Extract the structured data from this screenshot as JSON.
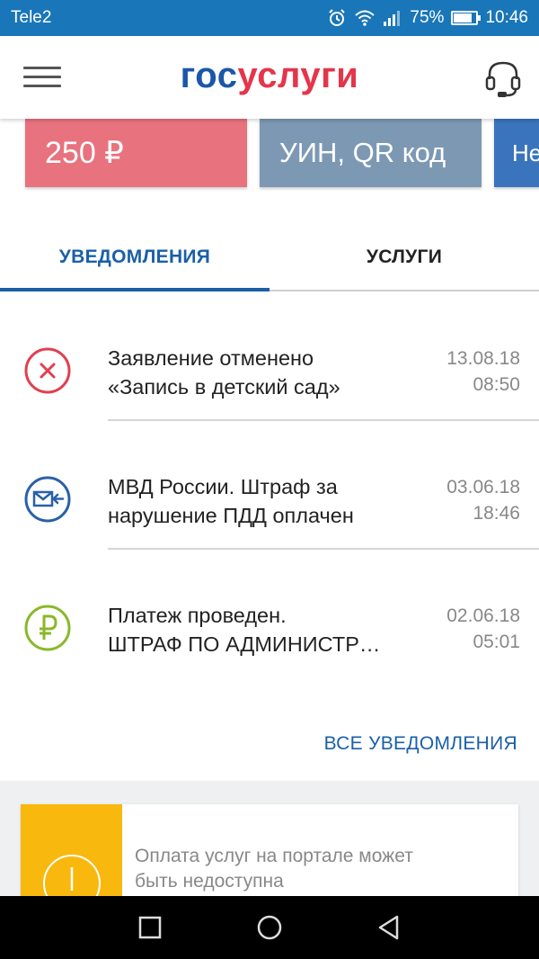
{
  "status_bar": {
    "carrier": "Tele2",
    "battery_percent": "75%",
    "battery_level": 0.75,
    "time": "10:46"
  },
  "header": {
    "logo_part1": "гос",
    "logo_part2": "услуги",
    "menu_icon": "hamburger-menu-icon",
    "support_icon": "headset-icon"
  },
  "cards": [
    {
      "label": "250 ₽"
    },
    {
      "label": "УИН, QR код"
    },
    {
      "label": "Не"
    }
  ],
  "tabs": [
    {
      "label": "УВЕДОМЛЕНИЯ",
      "active": true
    },
    {
      "label": "УСЛУГИ",
      "active": false
    }
  ],
  "notifications": [
    {
      "icon": "cancel-icon",
      "line1": "Заявление отменено",
      "line2": "«Запись в детский сад»",
      "date": "13.08.18",
      "time": "08:50"
    },
    {
      "icon": "mail-incoming-icon",
      "line1": "МВД России. Штраф за",
      "line2": "нарушение ПДД оплачен",
      "date": "03.06.18",
      "time": "18:46"
    },
    {
      "icon": "ruble-icon",
      "line1": "Платеж проведен.",
      "line2": "ШТРАФ ПО АДМИНИСТР…",
      "date": "02.06.18",
      "time": "05:01"
    }
  ],
  "all_notifications_label": "ВСЕ УВЕДОМЛЕНИЯ",
  "banner": {
    "line1": "Оплата услуг на портале может",
    "line2": "быть недоступна",
    "icon": "warning-icon"
  },
  "nav_bar": {
    "recent_icon": "recent-apps-icon",
    "home_icon": "home-icon",
    "back_icon": "back-icon"
  },
  "colors": {
    "status_bar": "#1976b8",
    "accent": "#1a5fa8",
    "logo_red": "#e5354b",
    "card_red": "#e8727e",
    "card_grey": "#7d98b3",
    "card_blue": "#3a74bc",
    "cancel_red": "#e0404f",
    "mail_blue": "#2960a8",
    "ruble_green": "#8ab82a",
    "banner_yellow": "#f9b80e"
  }
}
